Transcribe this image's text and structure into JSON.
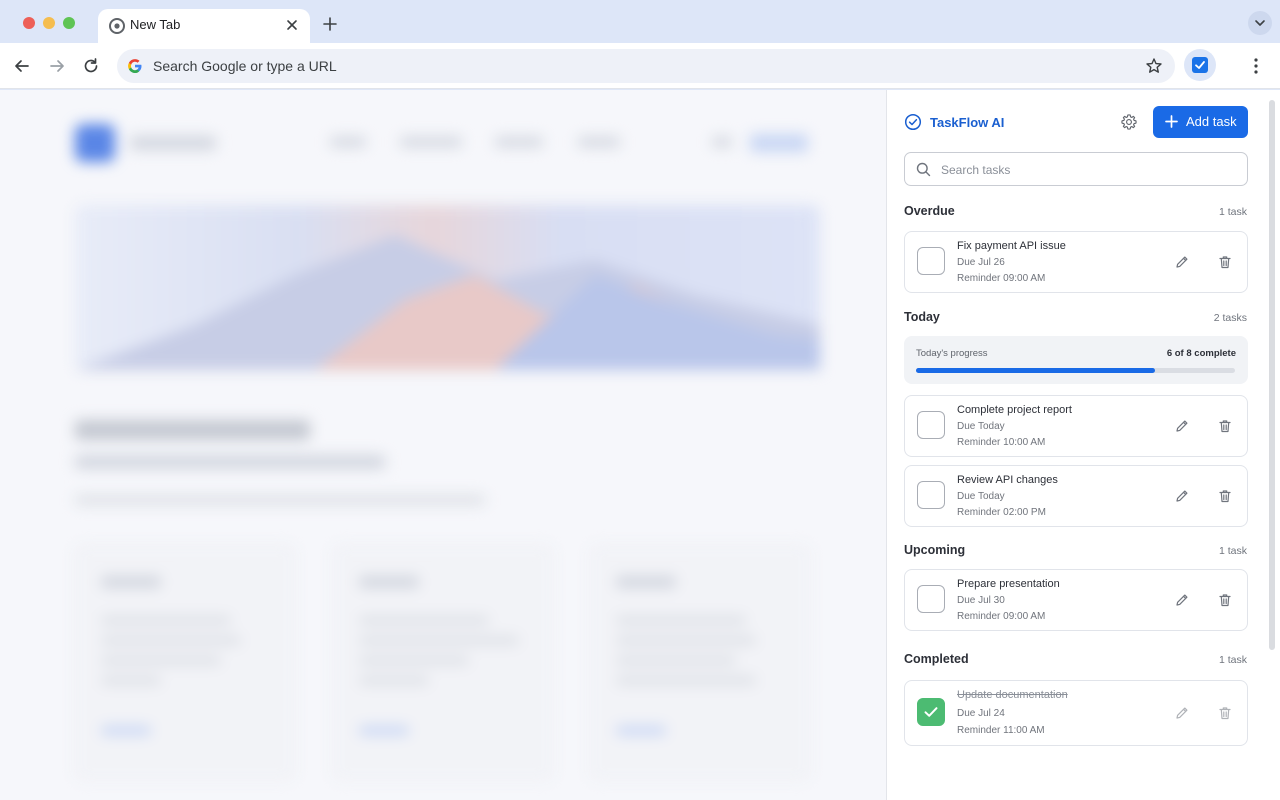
{
  "browser": {
    "tab_title": "New Tab",
    "omnibox_placeholder": "Search Google or type a URL"
  },
  "panel": {
    "app_name": "TaskFlow AI",
    "add_task_label": "Add task",
    "search_placeholder": "Search tasks",
    "accent_color": "#1a6ae6",
    "sections": {
      "overdue": {
        "title": "Overdue",
        "count": "1 task",
        "tasks": [
          {
            "title": "Fix payment API issue",
            "due": "Due Jul 26",
            "reminder": "Reminder 09:00 AM",
            "completed": false
          }
        ]
      },
      "today": {
        "title": "Today",
        "count": "2 tasks",
        "progress_label": "Today's progress",
        "progress_value": "6 of 8 complete",
        "progress_fraction": 0.75,
        "tasks": [
          {
            "title": "Complete project report",
            "due": "Due Today",
            "reminder": "Reminder 10:00 AM",
            "completed": false
          },
          {
            "title": "Review API changes",
            "due": "Due Today",
            "reminder": "Reminder 02:00 PM",
            "completed": false
          }
        ]
      },
      "upcoming": {
        "title": "Upcoming",
        "count": "1 task",
        "tasks": [
          {
            "title": "Prepare presentation",
            "due": "Due Jul 30",
            "reminder": "Reminder 09:00 AM",
            "completed": false
          }
        ]
      },
      "completed": {
        "title": "Completed",
        "count": "1 task",
        "tasks": [
          {
            "title": "Update documentation",
            "due": "Due Jul 24",
            "reminder": "Reminder 11:00 AM",
            "completed": true
          }
        ]
      }
    }
  }
}
